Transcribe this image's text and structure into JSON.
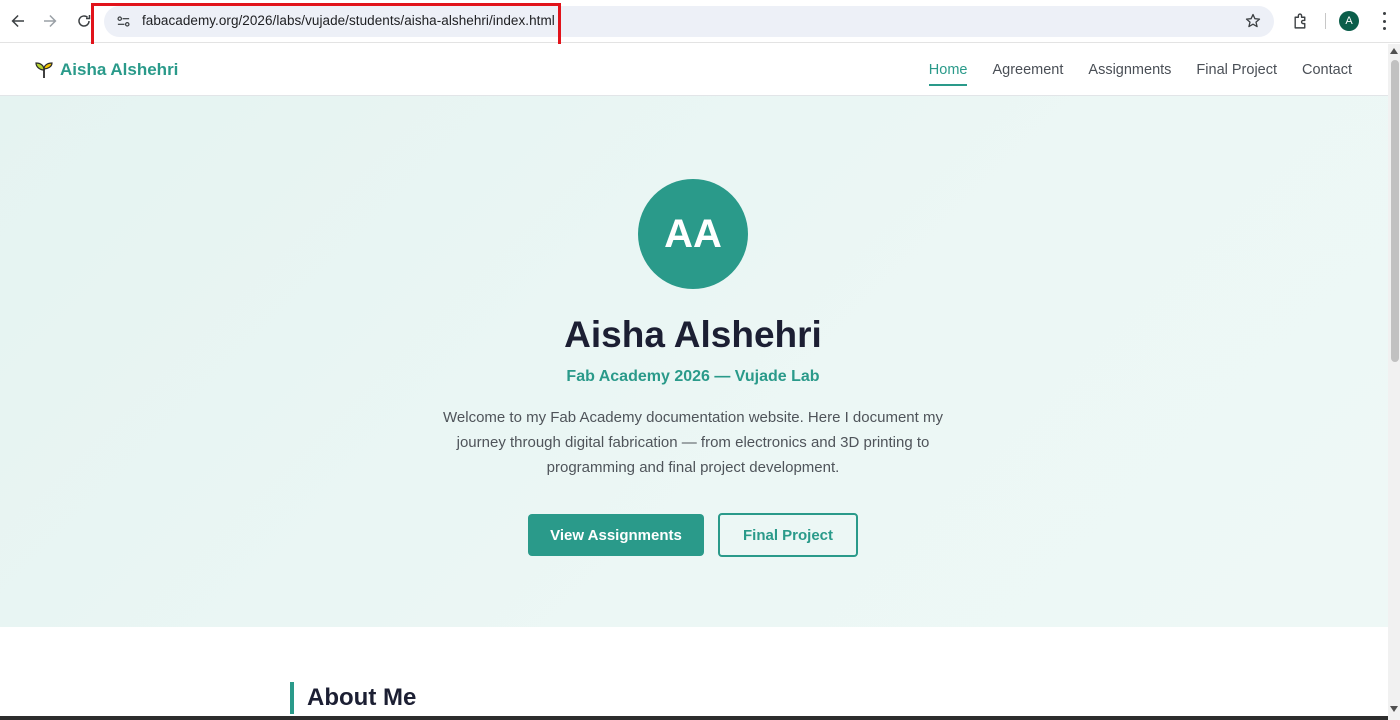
{
  "browser": {
    "url": "fabacademy.org/2026/labs/vujade/students/aisha-alshehri/index.html",
    "profile_initial": "A"
  },
  "site": {
    "brand_name": "Aisha Alshehri",
    "nav": [
      {
        "label": "Home",
        "active": true
      },
      {
        "label": "Agreement",
        "active": false
      },
      {
        "label": "Assignments",
        "active": false
      },
      {
        "label": "Final Project",
        "active": false
      },
      {
        "label": "Contact",
        "active": false
      }
    ]
  },
  "hero": {
    "avatar_initials": "AA",
    "title": "Aisha Alshehri",
    "subtitle": "Fab Academy 2026 — Vujade Lab",
    "description": "Welcome to my Fab Academy documentation website. Here I document my journey through digital fabrication — from electronics and 3D printing to programming and final project development.",
    "primary_button": "View Assignments",
    "secondary_button": "Final Project"
  },
  "about": {
    "title": "About Me"
  },
  "colors": {
    "accent": "#2a9a8a",
    "heading": "#1c1f33",
    "highlight": "#e1131b"
  }
}
